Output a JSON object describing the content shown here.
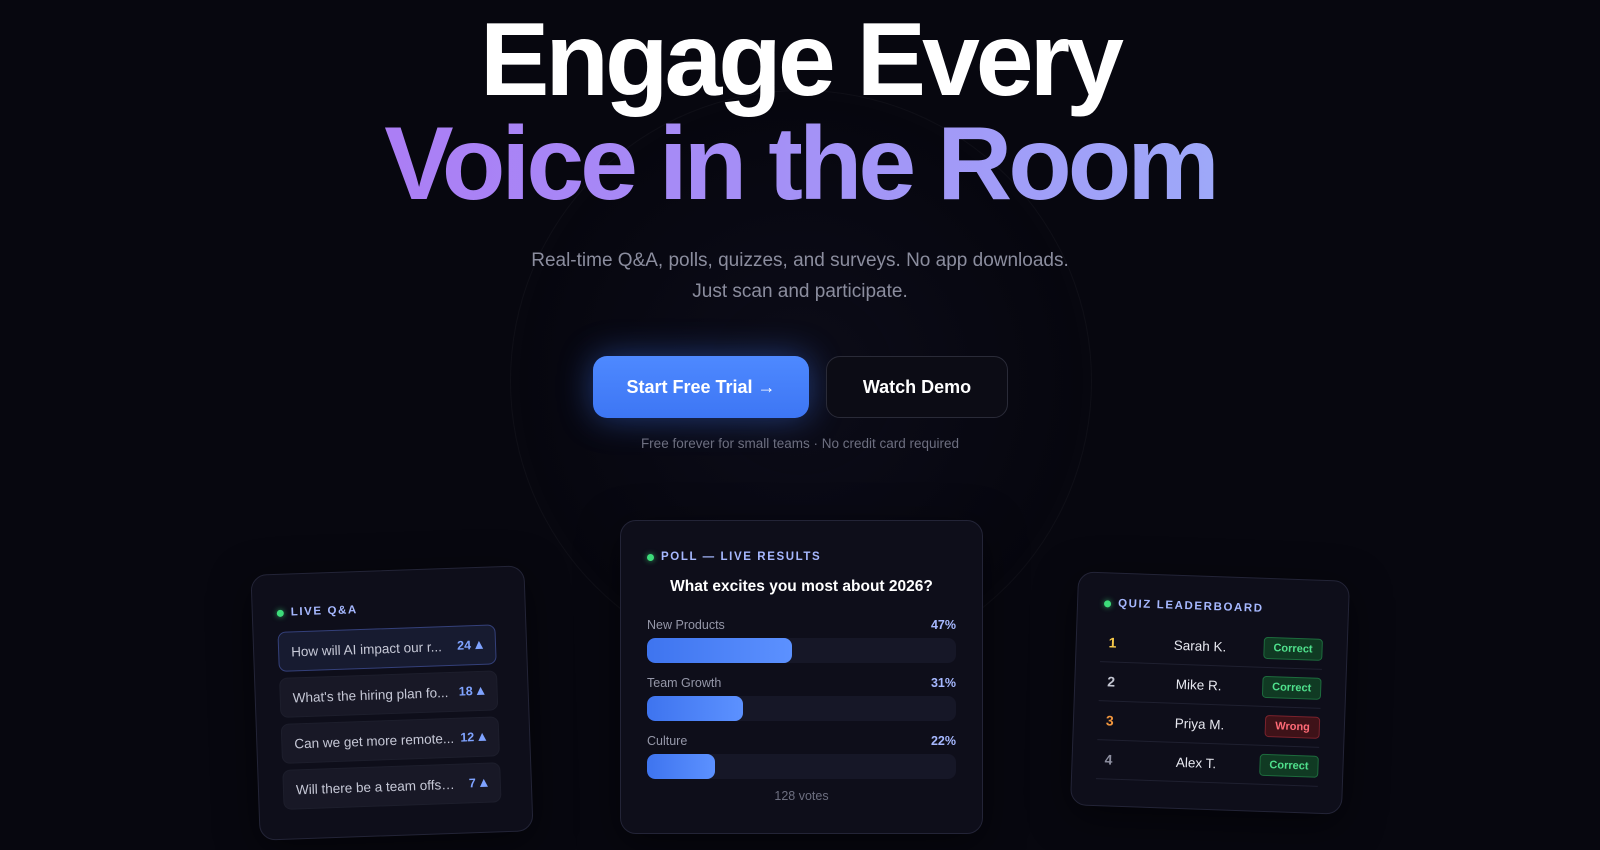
{
  "hero": {
    "title_line1": "Engage Every",
    "title_line2": "Voice in the Room",
    "subtitle_line1": "Real-time Q&A, polls, quizzes, and surveys. No app downloads.",
    "subtitle_line2": "Just scan and participate.",
    "primary_cta": "Start Free Trial →",
    "secondary_cta": "Watch Demo",
    "fine_print": "Free forever for small teams · No credit card required"
  },
  "qa_card": {
    "label": "LIVE Q&A",
    "items": [
      {
        "text": "How will AI impact our r...",
        "votes": "24"
      },
      {
        "text": "What's the hiring plan fo...",
        "votes": "18"
      },
      {
        "text": "Can we get more remote...",
        "votes": "12"
      },
      {
        "text": "Will there be a team offsit...",
        "votes": "7"
      }
    ]
  },
  "poll_card": {
    "label": "POLL — LIVE RESULTS",
    "question": "What excites you most about 2026?",
    "options": [
      {
        "label": "New Products",
        "percent": "47%",
        "value": 47
      },
      {
        "label": "Team Growth",
        "percent": "31%",
        "value": 31
      },
      {
        "label": "Culture",
        "percent": "22%",
        "value": 22
      }
    ],
    "total": "128 votes"
  },
  "leaderboard_card": {
    "label": "QUIZ LEADERBOARD",
    "rows": [
      {
        "rank": "1",
        "name": "Sarah K.",
        "status": "Correct",
        "rank_color": "#f5c84a"
      },
      {
        "rank": "2",
        "name": "Mike R.",
        "status": "Correct",
        "rank_color": "#c3c5d1"
      },
      {
        "rank": "3",
        "name": "Priya M.",
        "status": "Wrong",
        "rank_color": "#f0953d"
      },
      {
        "rank": "4",
        "name": "Alex T.",
        "status": "Correct",
        "rank_color": "#8d8fa0"
      }
    ]
  },
  "colors": {
    "accent": "#4e89ff",
    "correct": "#4fe08c",
    "wrong": "#ff6a76",
    "live_dot": "#3ddc7a"
  }
}
